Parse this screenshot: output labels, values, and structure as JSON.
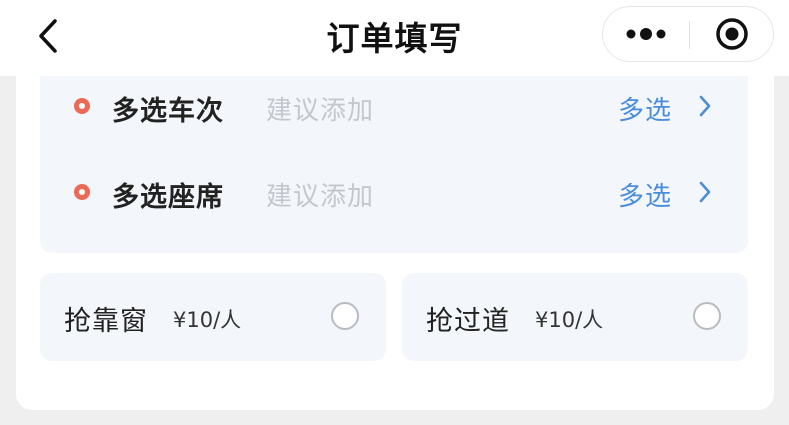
{
  "navbar": {
    "title": "订单填写",
    "back_icon": "chevron-left-icon",
    "more_icon": "more-dots-icon",
    "close_icon": "target-close-icon"
  },
  "multi_select": {
    "rows": [
      {
        "label": "多选车次",
        "hint": "建议添加",
        "action": "多选"
      },
      {
        "label": "多选座席",
        "hint": "建议添加",
        "action": "多选"
      }
    ],
    "dot_color": "#ec6a55",
    "action_color": "#4a8edb"
  },
  "options": [
    {
      "label": "抢靠窗",
      "price": "¥10/人",
      "selected": false
    },
    {
      "label": "抢过道",
      "price": "¥10/人",
      "selected": false
    }
  ]
}
